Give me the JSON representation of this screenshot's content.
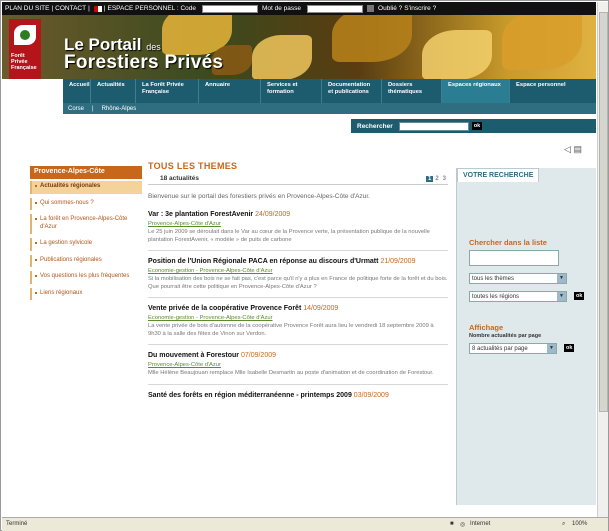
{
  "topbar": {
    "links": [
      "PLAN DU SITE",
      "CONTACT"
    ],
    "espace_label": "ESPACE PERSONNEL : Code",
    "password_label": "Mot de passe",
    "forgot": "Oublié ?",
    "register": "S'inscrire ?"
  },
  "header": {
    "title_line1": "Le Portail",
    "title_des": "des",
    "title_line2": "Forestiers Privés",
    "logo_text": "Forêt Privée Française"
  },
  "nav": {
    "items": [
      "Accueil",
      "Actualités",
      "La Forêt Privée Française",
      "Annuaire",
      "Services et formation",
      "Documentation et publications",
      "Dossiers thématiques",
      "Espaces régionaux",
      "Espace personnel"
    ],
    "subitems": [
      "Corse",
      "Rhône-Alpes"
    ],
    "search_label": "Rechercher",
    "ok": "ok"
  },
  "sidebar": {
    "title": "Provence-Alpes-Côte",
    "items": [
      "Actualités régionales",
      "Qui sommes-nous ?",
      "La forêt en Provence-Alpes-Côte d'Azur",
      "La gestion sylvicole",
      "Publications régionales",
      "Vos questions les plus fréquentes",
      "Liens régionaux"
    ]
  },
  "main": {
    "title": "TOUS LES THEMES",
    "count": "18 actualités",
    "pages": [
      "1",
      "2",
      "3"
    ],
    "intro": "Bienvenue sur le portail des forestiers privés en Provence-Alpes-Côte d'Azur.",
    "articles": [
      {
        "title": "Var : 3e plantation ForestAvenir",
        "date": "24/09/2009",
        "cat": "Provence-Alpes-Côte d'Azur",
        "text": "Le 25 juin 2009 se déroulait dans le Var au cœur de la Provence verte, la présentation publique de la nouvelle plantation ForestAvenir, « modèle » de puits de carbone"
      },
      {
        "title": "Position de l'Union Régionale PACA en réponse au discours d'Urmatt",
        "date": "21/09/2009",
        "cat": "Economie-gestion - Provence-Alpes-Côte d'Azur",
        "text": "Si la mobilisation des bois ne se fait pas, c'est parce qu'il n'y a plus en France de politique forte de la forêt et du bois. Que pourrait être cette politique en Provence-Alpes-Côte d'Azur ?"
      },
      {
        "title": "Vente privée de la coopérative Provence Forêt",
        "date": "14/09/2009",
        "cat": "Economie-gestion - Provence-Alpes-Côte d'Azur",
        "text": "La vente privée de bois d'automne de la coopérative Provence Forêt aura lieu le vendredi 18 septembre 2009 à 9h30 à la salle des fêtes de Vinon sur Verdon."
      },
      {
        "title": "Du mouvement à Forestour",
        "date": "07/09/2009",
        "cat": "Provence-Alpes-Côte d'Azur",
        "text": "Mlle Hélène Beaujouan remplace Mlle Isabelle Desmartin au poste d'animation et de coordination de Forestour."
      },
      {
        "title": "Santé des forêts en région méditerranéenne - printemps 2009",
        "date": "03/09/2009",
        "cat": "",
        "text": ""
      }
    ]
  },
  "right": {
    "tab": "VOTRE RECHERCHE",
    "search_title": "Chercher dans la liste",
    "themes_select": "tous les thèmes",
    "regions_select": "toutes les régions",
    "ok": "ok",
    "affichage": "Affichage",
    "per_page_label": "Nombre actualités par page",
    "per_page_select": "8 actualités par page"
  },
  "status": {
    "left": "Terminé",
    "zone": "Internet",
    "zoom": "100%"
  }
}
